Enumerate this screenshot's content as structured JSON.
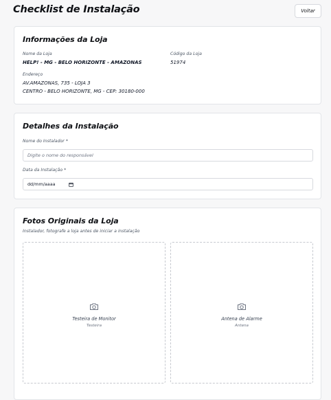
{
  "header": {
    "title": "Checklist de Instalação",
    "back_label": "Voltar"
  },
  "store_info": {
    "title": "Informações da Loja",
    "name_label": "Nome da Loja",
    "name_value": "HELP! - MG - BELO HORIZONTE - AMAZONAS",
    "code_label": "Código da Loja",
    "code_value": "51974",
    "address_label": "Endereço",
    "address_line1": "AV.AMAZONAS, 735 - LOJA 3",
    "address_line2": "CENTRO - BELO HORIZONTE, MG - CEP: 30180-000"
  },
  "installation": {
    "title": "Detalhes da Instalação",
    "installer_label": "Nome do Instalador *",
    "installer_placeholder": "Digite o nome do responsável",
    "date_label": "Data da Instalação *",
    "date_placeholder": "dd/mm/aaaa"
  },
  "photos": {
    "title": "Fotos Originais da Loja",
    "subtitle": "Instalador, fotografe a loja antes de iniciar a instalação",
    "slots": [
      {
        "label": "Testeira de Monitor",
        "sub": "Testeira"
      },
      {
        "label": "Antena de Alarme",
        "sub": "Antena"
      }
    ]
  },
  "icons": {
    "camera": "camera-icon",
    "calendar": "calendar-icon"
  }
}
